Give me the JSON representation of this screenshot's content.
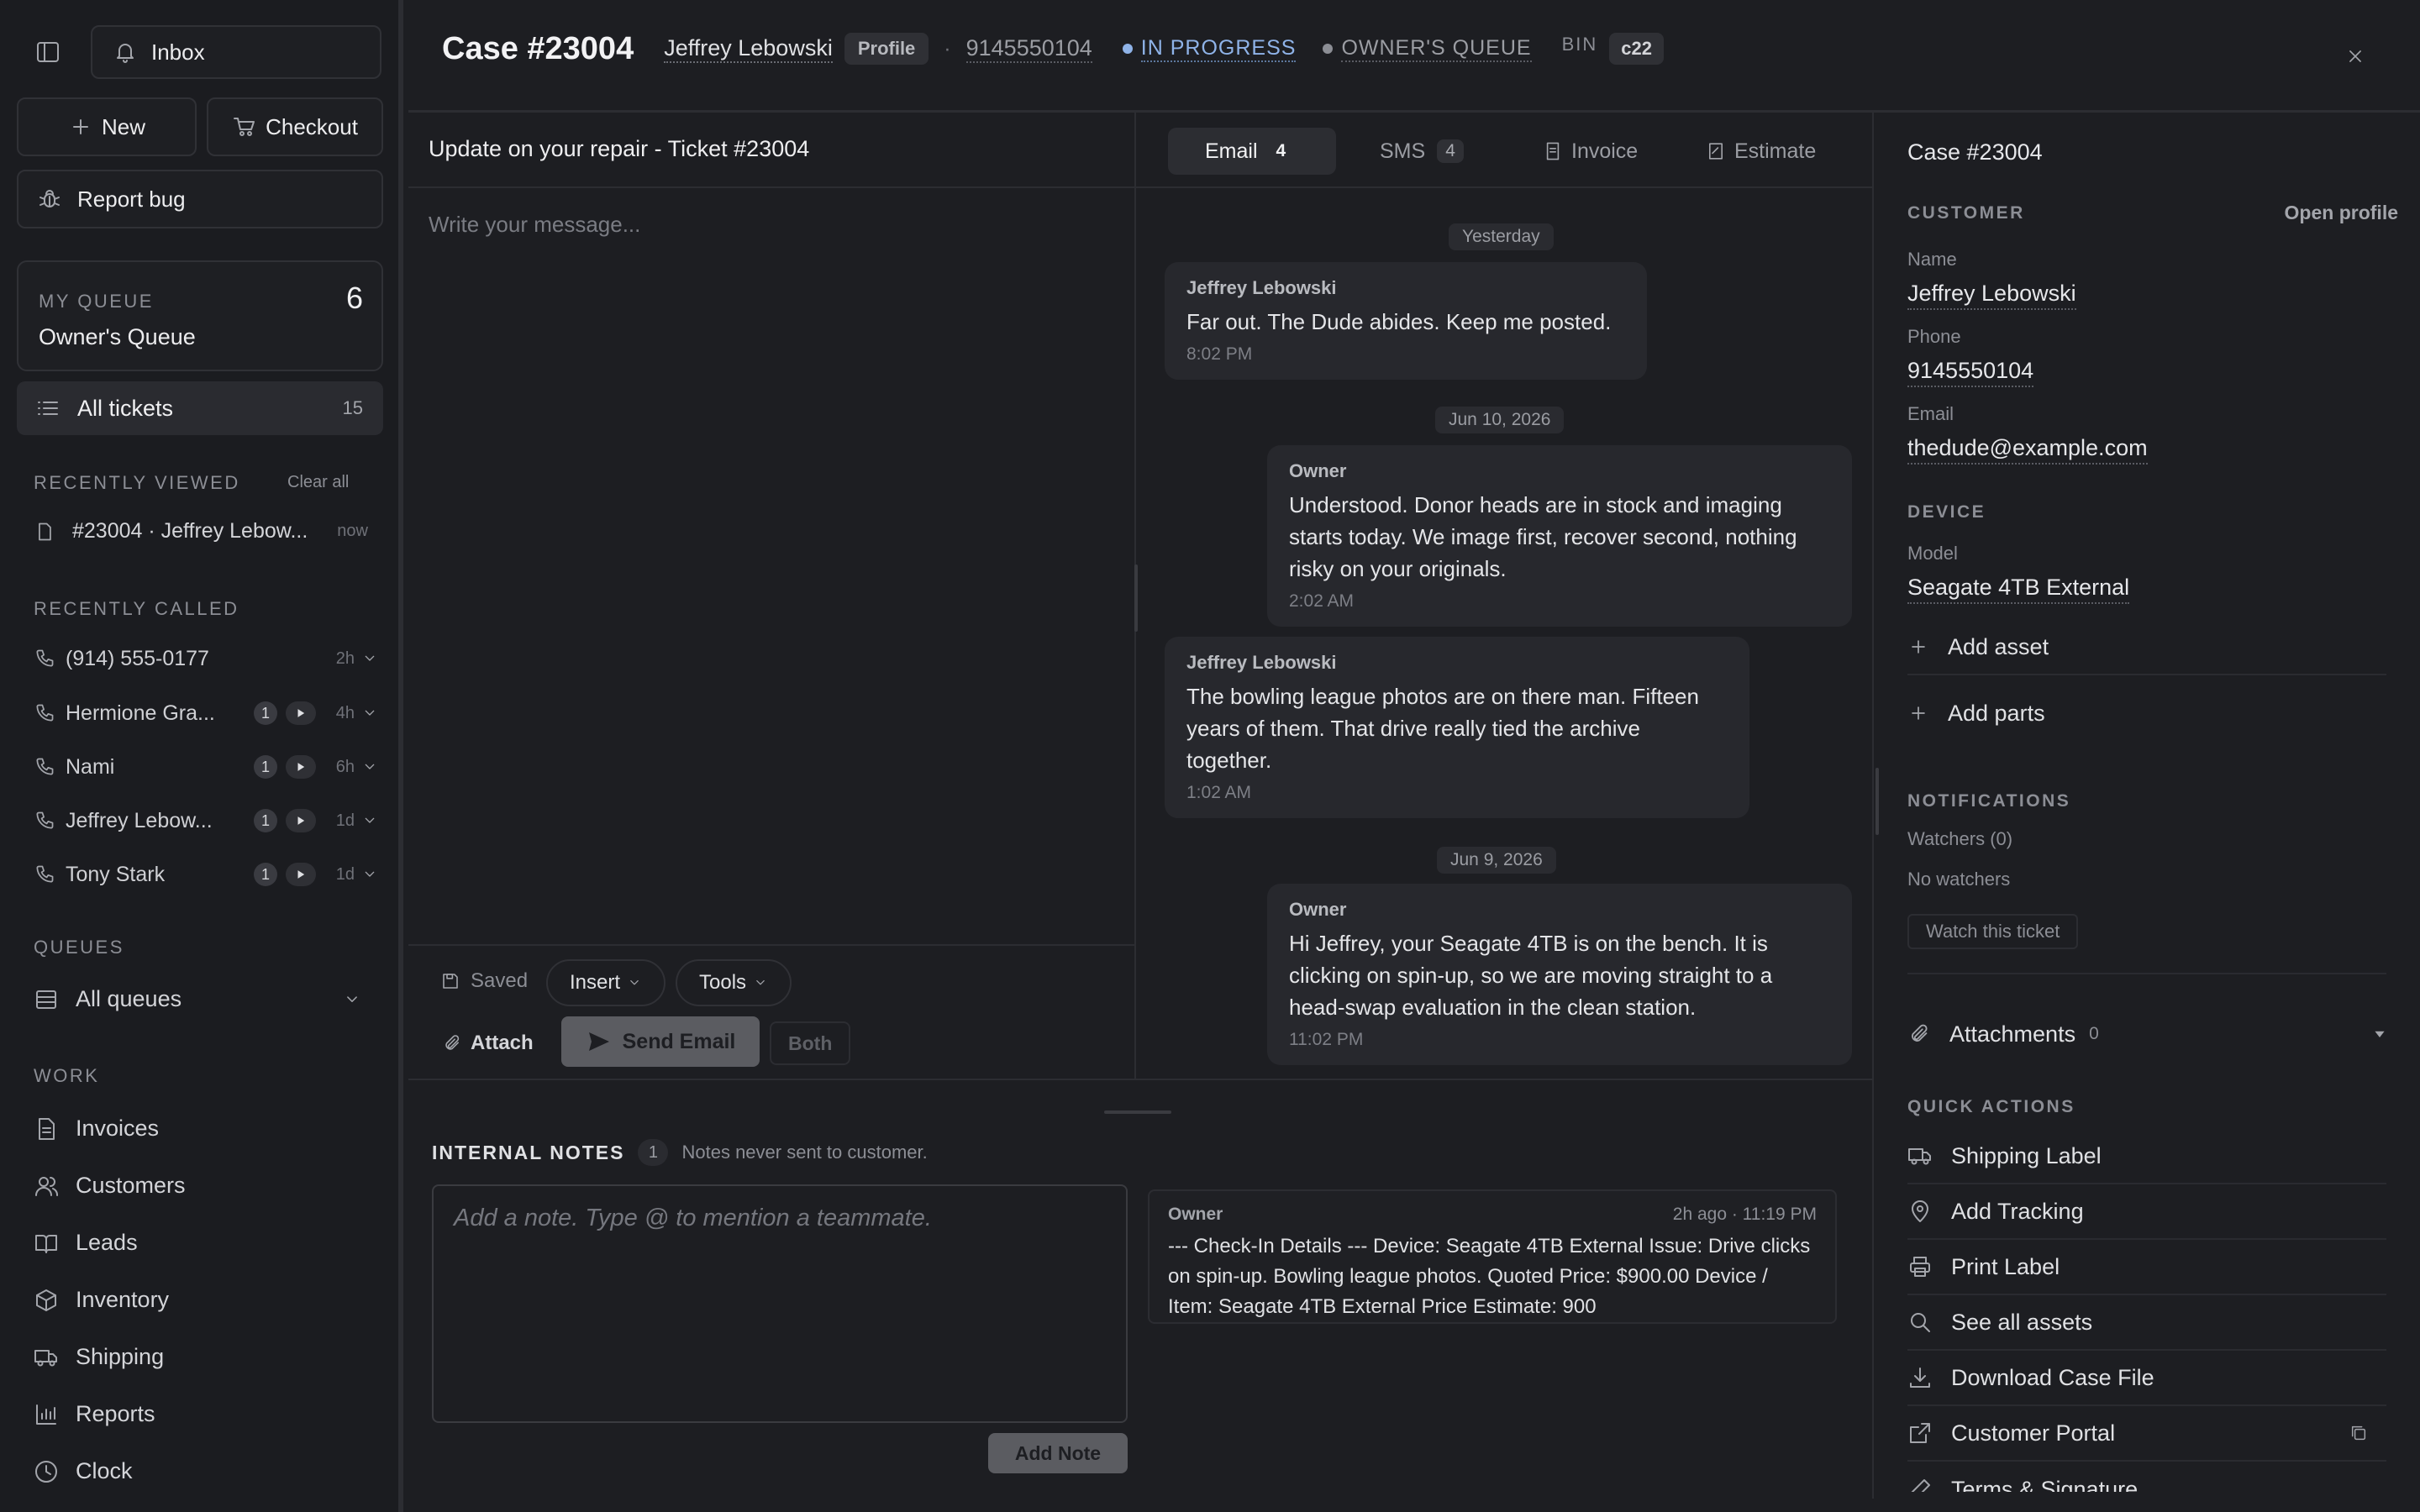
{
  "sidebar": {
    "inbox_label": "Inbox",
    "new_label": "New",
    "checkout_label": "Checkout",
    "report_bug_label": "Report bug",
    "my_queue": {
      "label": "MY QUEUE",
      "name": "Owner's Queue",
      "count": "6"
    },
    "all_tickets": {
      "label": "All tickets",
      "count": "15"
    },
    "recently_viewed": {
      "title": "RECENTLY VIEWED",
      "clear_label": "Clear all",
      "items": [
        {
          "label": "#23004 · Jeffrey Lebow...",
          "time": "now"
        }
      ]
    },
    "recently_called": {
      "title": "RECENTLY CALLED",
      "items": [
        {
          "name": "(914) 555-0177",
          "count": "",
          "time": "2h"
        },
        {
          "name": "Hermione Gra...",
          "count": "1",
          "time": "4h"
        },
        {
          "name": "Nami",
          "count": "1",
          "time": "6h"
        },
        {
          "name": "Jeffrey Lebow...",
          "count": "1",
          "time": "1d"
        },
        {
          "name": "Tony Stark",
          "count": "1",
          "time": "1d"
        }
      ]
    },
    "queues": {
      "title": "QUEUES",
      "all_queues_label": "All queues"
    },
    "work": {
      "title": "WORK",
      "items": [
        {
          "label": "Invoices",
          "icon": "invoice-icon"
        },
        {
          "label": "Customers",
          "icon": "users-icon"
        },
        {
          "label": "Leads",
          "icon": "book-icon"
        },
        {
          "label": "Inventory",
          "icon": "box-icon"
        },
        {
          "label": "Shipping",
          "icon": "truck-icon"
        },
        {
          "label": "Reports",
          "icon": "chart-icon"
        },
        {
          "label": "Clock",
          "icon": "clock-icon"
        }
      ]
    }
  },
  "header": {
    "case_title": "Case #23004",
    "customer_name": "Jeffrey Lebowski",
    "profile_label": "Profile",
    "phone": "9145550104",
    "status": "IN PROGRESS",
    "queue": "OWNER'S QUEUE",
    "bin_label": "BIN",
    "bin_value": "c22"
  },
  "composer": {
    "subject": "Update on your repair - Ticket #23004",
    "placeholder": "Write your message...",
    "saved_label": "Saved",
    "insert_label": "Insert",
    "tools_label": "Tools",
    "attach_label": "Attach",
    "send_label": "Send Email",
    "both_label": "Both"
  },
  "tabs": {
    "email": {
      "label": "Email",
      "count": "4"
    },
    "sms": {
      "label": "SMS",
      "count": "4"
    },
    "invoice": {
      "label": "Invoice"
    },
    "estimate": {
      "label": "Estimate"
    }
  },
  "conversation": {
    "date_yesterday": "Yesterday",
    "date_jun10": "Jun 10, 2026",
    "date_jun9": "Jun 9, 2026",
    "messages": [
      {
        "sender": "Jeffrey Lebowski",
        "text": "Far out. The Dude abides. Keep me posted.",
        "time": "8:02 PM"
      },
      {
        "sender": "Owner",
        "text": "Understood. Donor heads are in stock and imaging starts today. We image first, recover second, nothing risky on your originals.",
        "time": "2:02 AM"
      },
      {
        "sender": "Jeffrey Lebowski",
        "text": "The bowling league photos are on there man. Fifteen years of them. That drive really tied the archive together.",
        "time": "1:02 AM"
      },
      {
        "sender": "Owner",
        "text": "Hi Jeffrey, your Seagate 4TB is on the bench. It is clicking on spin-up, so we are moving straight to a head-swap evaluation in the clean station.",
        "time": "11:02 PM"
      }
    ]
  },
  "notes": {
    "title": "INTERNAL NOTES",
    "count": "1",
    "hint": "Notes never sent to customer.",
    "placeholder": "Add a note. Type @ to mention a teammate.",
    "add_label": "Add Note",
    "entry": {
      "author": "Owner",
      "time": "2h ago · 11:19 PM",
      "text": "--- Check-In Details --- Device: Seagate 4TB External Issue: Drive clicks on spin-up. Bowling league photos. Quoted Price: $900.00 Device / Item: Seagate 4TB External Price Estimate: 900"
    }
  },
  "details": {
    "case_title": "Case #23004",
    "customer_section": "CUSTOMER",
    "open_profile_label": "Open profile",
    "name_label": "Name",
    "name_value": "Jeffrey Lebowski",
    "phone_label": "Phone",
    "phone_value": "9145550104",
    "email_label": "Email",
    "email_value": "thedude@example.com",
    "device_section": "DEVICE",
    "model_label": "Model",
    "model_value": "Seagate 4TB External",
    "add_asset_label": "Add asset",
    "add_parts_label": "Add parts",
    "notifications_section": "NOTIFICATIONS",
    "watchers_label": "Watchers (0)",
    "no_watchers_label": "No watchers",
    "watch_label": "Watch this ticket",
    "attachments_label": "Attachments",
    "attachments_count": "0",
    "quick_actions_section": "QUICK ACTIONS",
    "quick_actions": [
      {
        "label": "Shipping Label",
        "icon": "truck-icon"
      },
      {
        "label": "Add Tracking",
        "icon": "map-pin-icon"
      },
      {
        "label": "Print Label",
        "icon": "printer-icon"
      },
      {
        "label": "See all assets",
        "icon": "search-icon"
      },
      {
        "label": "Download Case File",
        "icon": "download-icon"
      },
      {
        "label": "Customer Portal",
        "icon": "external-link-icon"
      },
      {
        "label": "Terms & Signature",
        "icon": "pen-icon"
      }
    ]
  },
  "colors": {
    "accent": "#8fb3e8",
    "background": "#1d1e22",
    "panel": "#27282d"
  }
}
